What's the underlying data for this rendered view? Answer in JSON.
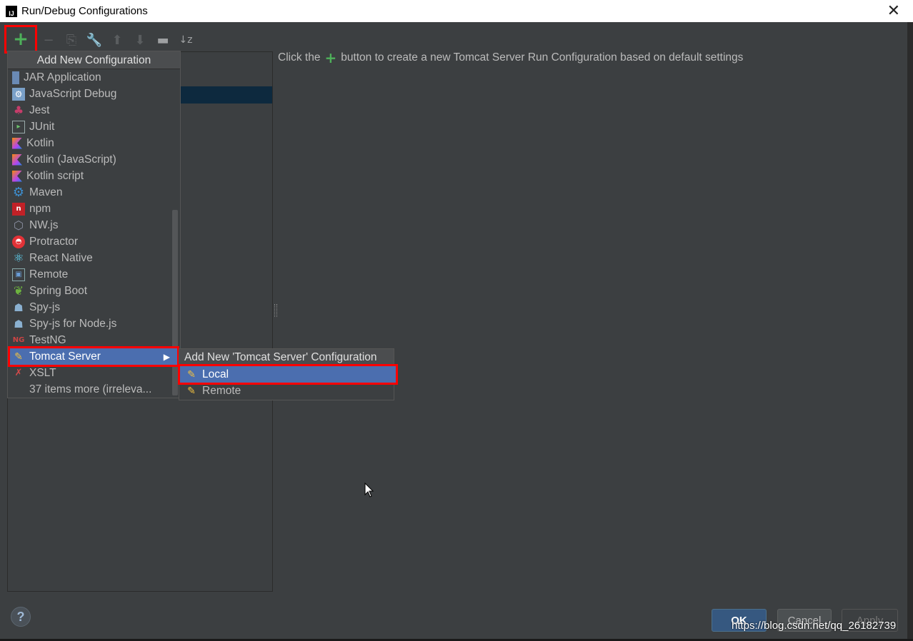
{
  "window": {
    "title": "Run/Debug Configurations",
    "close_glyph": "✕"
  },
  "toolbar": {
    "add": "+",
    "remove": "−",
    "copy": "⎘",
    "edit_defaults": "🔧",
    "move_up": "⬆",
    "move_down": "⬇",
    "folder": "▬",
    "sort": "↓z"
  },
  "hint": {
    "before": "Click the",
    "plus": "+",
    "after": "button to create a new Tomcat Server Run Configuration based on default settings"
  },
  "popup": {
    "header": "Add New Configuration",
    "items": [
      {
        "label": "JAR Application",
        "icon": "jar-icon",
        "glyph": ""
      },
      {
        "label": "JavaScript Debug",
        "icon": "javascript-debug-icon",
        "glyph": "⚙"
      },
      {
        "label": "Jest",
        "icon": "jest-icon",
        "glyph": "♣"
      },
      {
        "label": "JUnit",
        "icon": "junit-icon",
        "glyph": "▸"
      },
      {
        "label": "Kotlin",
        "icon": "kotlin-icon",
        "glyph": ""
      },
      {
        "label": "Kotlin (JavaScript)",
        "icon": "kotlin-icon",
        "glyph": ""
      },
      {
        "label": "Kotlin script",
        "icon": "kotlin-icon",
        "glyph": ""
      },
      {
        "label": "Maven",
        "icon": "maven-gear-icon",
        "glyph": "⚙"
      },
      {
        "label": "npm",
        "icon": "npm-icon",
        "glyph": "n"
      },
      {
        "label": "NW.js",
        "icon": "nwjs-icon",
        "glyph": "⬡"
      },
      {
        "label": "Protractor",
        "icon": "protractor-icon",
        "glyph": "◓"
      },
      {
        "label": "React Native",
        "icon": "react-icon",
        "glyph": "⚛"
      },
      {
        "label": "Remote",
        "icon": "remote-icon",
        "glyph": "▣"
      },
      {
        "label": "Spring Boot",
        "icon": "spring-boot-icon",
        "glyph": "❦"
      },
      {
        "label": "Spy-js",
        "icon": "spyjs-icon",
        "glyph": "☗"
      },
      {
        "label": "Spy-js for Node.js",
        "icon": "spyjs-node-icon",
        "glyph": "☗"
      },
      {
        "label": "TestNG",
        "icon": "testng-icon",
        "glyph": "NG"
      },
      {
        "label": "Tomcat Server",
        "icon": "tomcat-icon",
        "glyph": "✎",
        "selected": true
      },
      {
        "label": "XSLT",
        "icon": "xslt-icon",
        "glyph": "✗"
      },
      {
        "label": "37 items more (irreleva...",
        "icon": "",
        "glyph": ""
      }
    ],
    "submenu_arrow": "▶"
  },
  "submenu": {
    "header": "Add New 'Tomcat Server' Configuration",
    "items": [
      {
        "label": "Local",
        "glyph": "✎",
        "selected": true
      },
      {
        "label": "Remote",
        "glyph": "✎"
      }
    ]
  },
  "footer": {
    "help": "?",
    "ok": "OK",
    "cancel": "Cancel",
    "apply": "Apply",
    "watermark": "https://blog.csdn.net/qq_26182739"
  }
}
